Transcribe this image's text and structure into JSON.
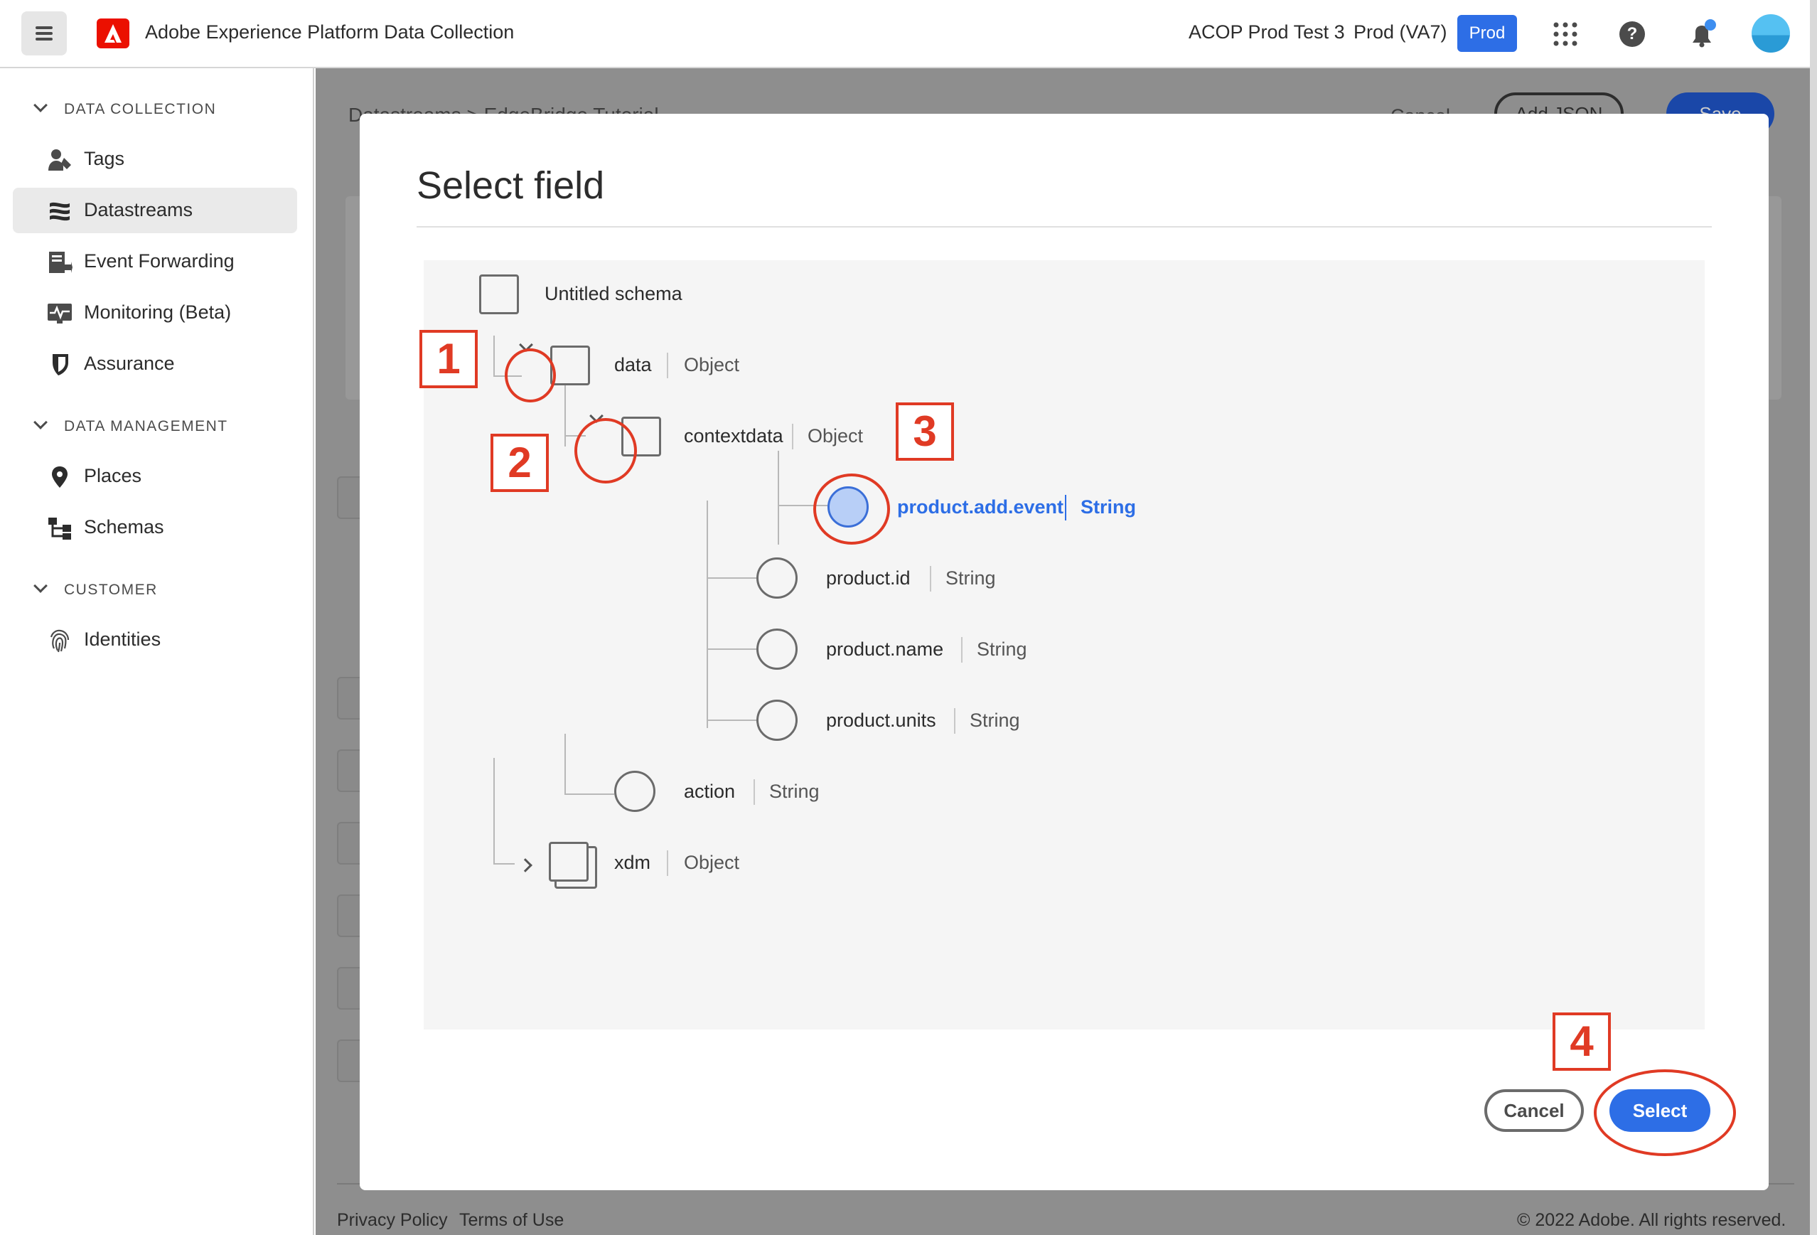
{
  "header": {
    "app_title": "Adobe Experience Platform Data Collection",
    "org_name": "ACOP Prod Test 3",
    "sandbox_name": "Prod (VA7)",
    "env_badge": "Prod",
    "brand_color": "#eb1000",
    "accent_color": "#2d6ee6"
  },
  "sidebar": {
    "sections": [
      {
        "label": "DATA COLLECTION",
        "items": [
          {
            "label": "Tags",
            "icon": "tags-icon"
          },
          {
            "label": "Datastreams",
            "icon": "datastreams-icon",
            "active": true
          },
          {
            "label": "Event Forwarding",
            "icon": "event-forwarding-icon"
          },
          {
            "label": "Monitoring (Beta)",
            "icon": "monitoring-icon"
          },
          {
            "label": "Assurance",
            "icon": "assurance-icon"
          }
        ]
      },
      {
        "label": "DATA MANAGEMENT",
        "items": [
          {
            "label": "Places",
            "icon": "places-icon"
          },
          {
            "label": "Schemas",
            "icon": "schemas-icon"
          }
        ]
      },
      {
        "label": "CUSTOMER",
        "items": [
          {
            "label": "Identities",
            "icon": "identities-icon"
          }
        ]
      }
    ]
  },
  "background_page": {
    "breadcrumb": "Datastreams  >  EdgeBridge Tutorial",
    "cancel_label": "Cancel",
    "add_json_label": "Add JSON",
    "save_label": "Save",
    "footer": {
      "privacy": "Privacy Policy",
      "terms": "Terms of Use",
      "copyright": "© 2022 Adobe. All rights reserved."
    }
  },
  "modal": {
    "title": "Select field",
    "tree": {
      "root": "Untitled schema",
      "data": {
        "name": "data",
        "type": "Object"
      },
      "contextdata": {
        "name": "contextdata",
        "type": "Object"
      },
      "fields": [
        {
          "name": "product.add.event",
          "type": "String",
          "selected": true
        },
        {
          "name": "product.id",
          "type": "String"
        },
        {
          "name": "product.name",
          "type": "String"
        },
        {
          "name": "product.units",
          "type": "String"
        }
      ],
      "action": {
        "name": "action",
        "type": "String"
      },
      "xdm": {
        "name": "xdm",
        "type": "Object"
      }
    },
    "cancel_label": "Cancel",
    "select_label": "Select"
  },
  "annotations": [
    "1",
    "2",
    "3",
    "4"
  ]
}
